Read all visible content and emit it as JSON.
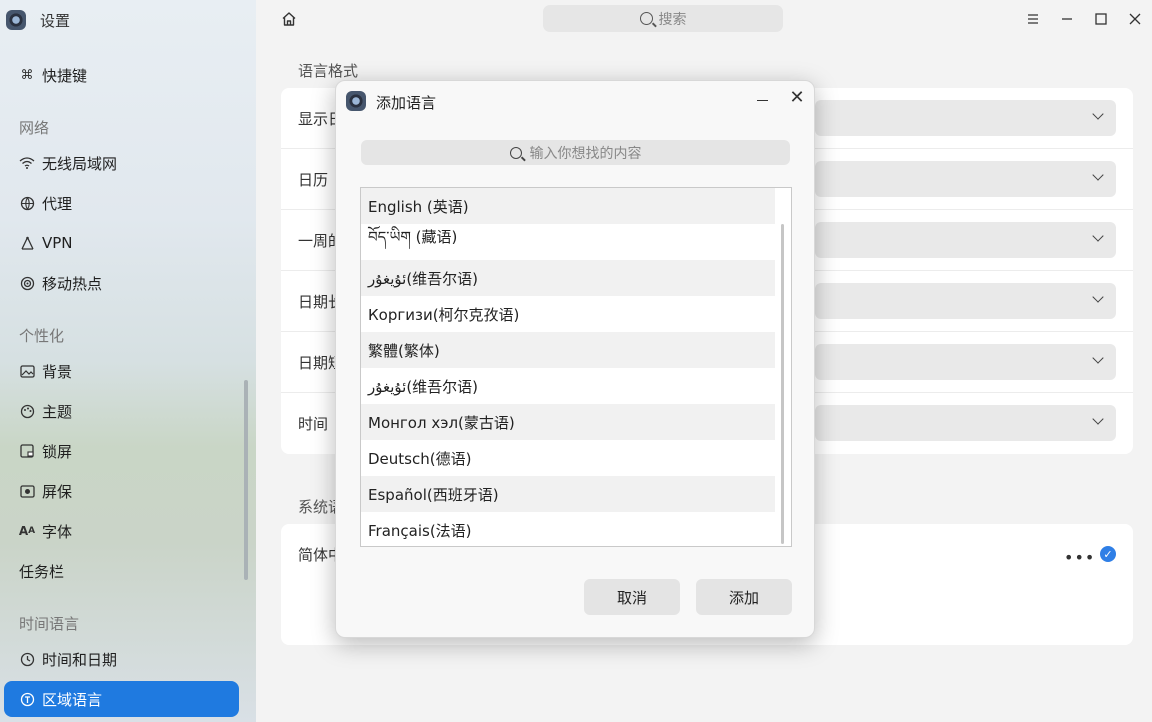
{
  "app": {
    "title": "设置",
    "icon": "settings-app-icon"
  },
  "sidebar": {
    "items": [
      {
        "label": "快捷键",
        "icon": "shortcut-icon"
      },
      {
        "category": "网络"
      },
      {
        "label": "无线局域网",
        "icon": "wifi-icon"
      },
      {
        "label": "代理",
        "icon": "proxy-icon"
      },
      {
        "label": "VPN",
        "icon": "vpn-icon"
      },
      {
        "label": "移动热点",
        "icon": "hotspot-icon"
      },
      {
        "category": "个性化"
      },
      {
        "label": "背景",
        "icon": "image-icon"
      },
      {
        "label": "主题",
        "icon": "palette-icon"
      },
      {
        "label": "锁屏",
        "icon": "lockscreen-icon"
      },
      {
        "label": "屏保",
        "icon": "screensaver-icon"
      },
      {
        "label": "字体",
        "icon": "font-icon"
      },
      {
        "label": "任务栏"
      },
      {
        "category": "时间语言"
      },
      {
        "label": "时间和日期",
        "icon": "clock-icon"
      },
      {
        "label": "区域语言",
        "icon": "region-icon",
        "active": true
      }
    ]
  },
  "topbar": {
    "search_placeholder": "搜索"
  },
  "main": {
    "section1_title": "语言格式",
    "format_rows": [
      {
        "label": "显示日"
      },
      {
        "label": "日历"
      },
      {
        "label": "一周的"
      },
      {
        "label": "日期长"
      },
      {
        "label": "日期短"
      },
      {
        "label": "时间"
      }
    ],
    "section2_title": "系统语",
    "system_lang_row": {
      "label": "简体中"
    }
  },
  "dialog": {
    "title": "添加语言",
    "search_placeholder": "输入你想找的内容",
    "languages": [
      "English (英语)",
      "བོད་ཡིག (藏语)",
      "ئۇيغۇر(维吾尔语)",
      "Коргизи(柯尔克孜语)",
      "繁體(繁体)",
      "ئۇيغۇر(维吾尔语)",
      "Монгол хэл(蒙古语)",
      "Deutsch(德语)",
      "Español(西班牙语)",
      "Français(法语)"
    ],
    "cancel_label": "取消",
    "add_label": "添加"
  },
  "colors": {
    "accent": "#1f7ae0",
    "check": "#2f7fe6"
  }
}
